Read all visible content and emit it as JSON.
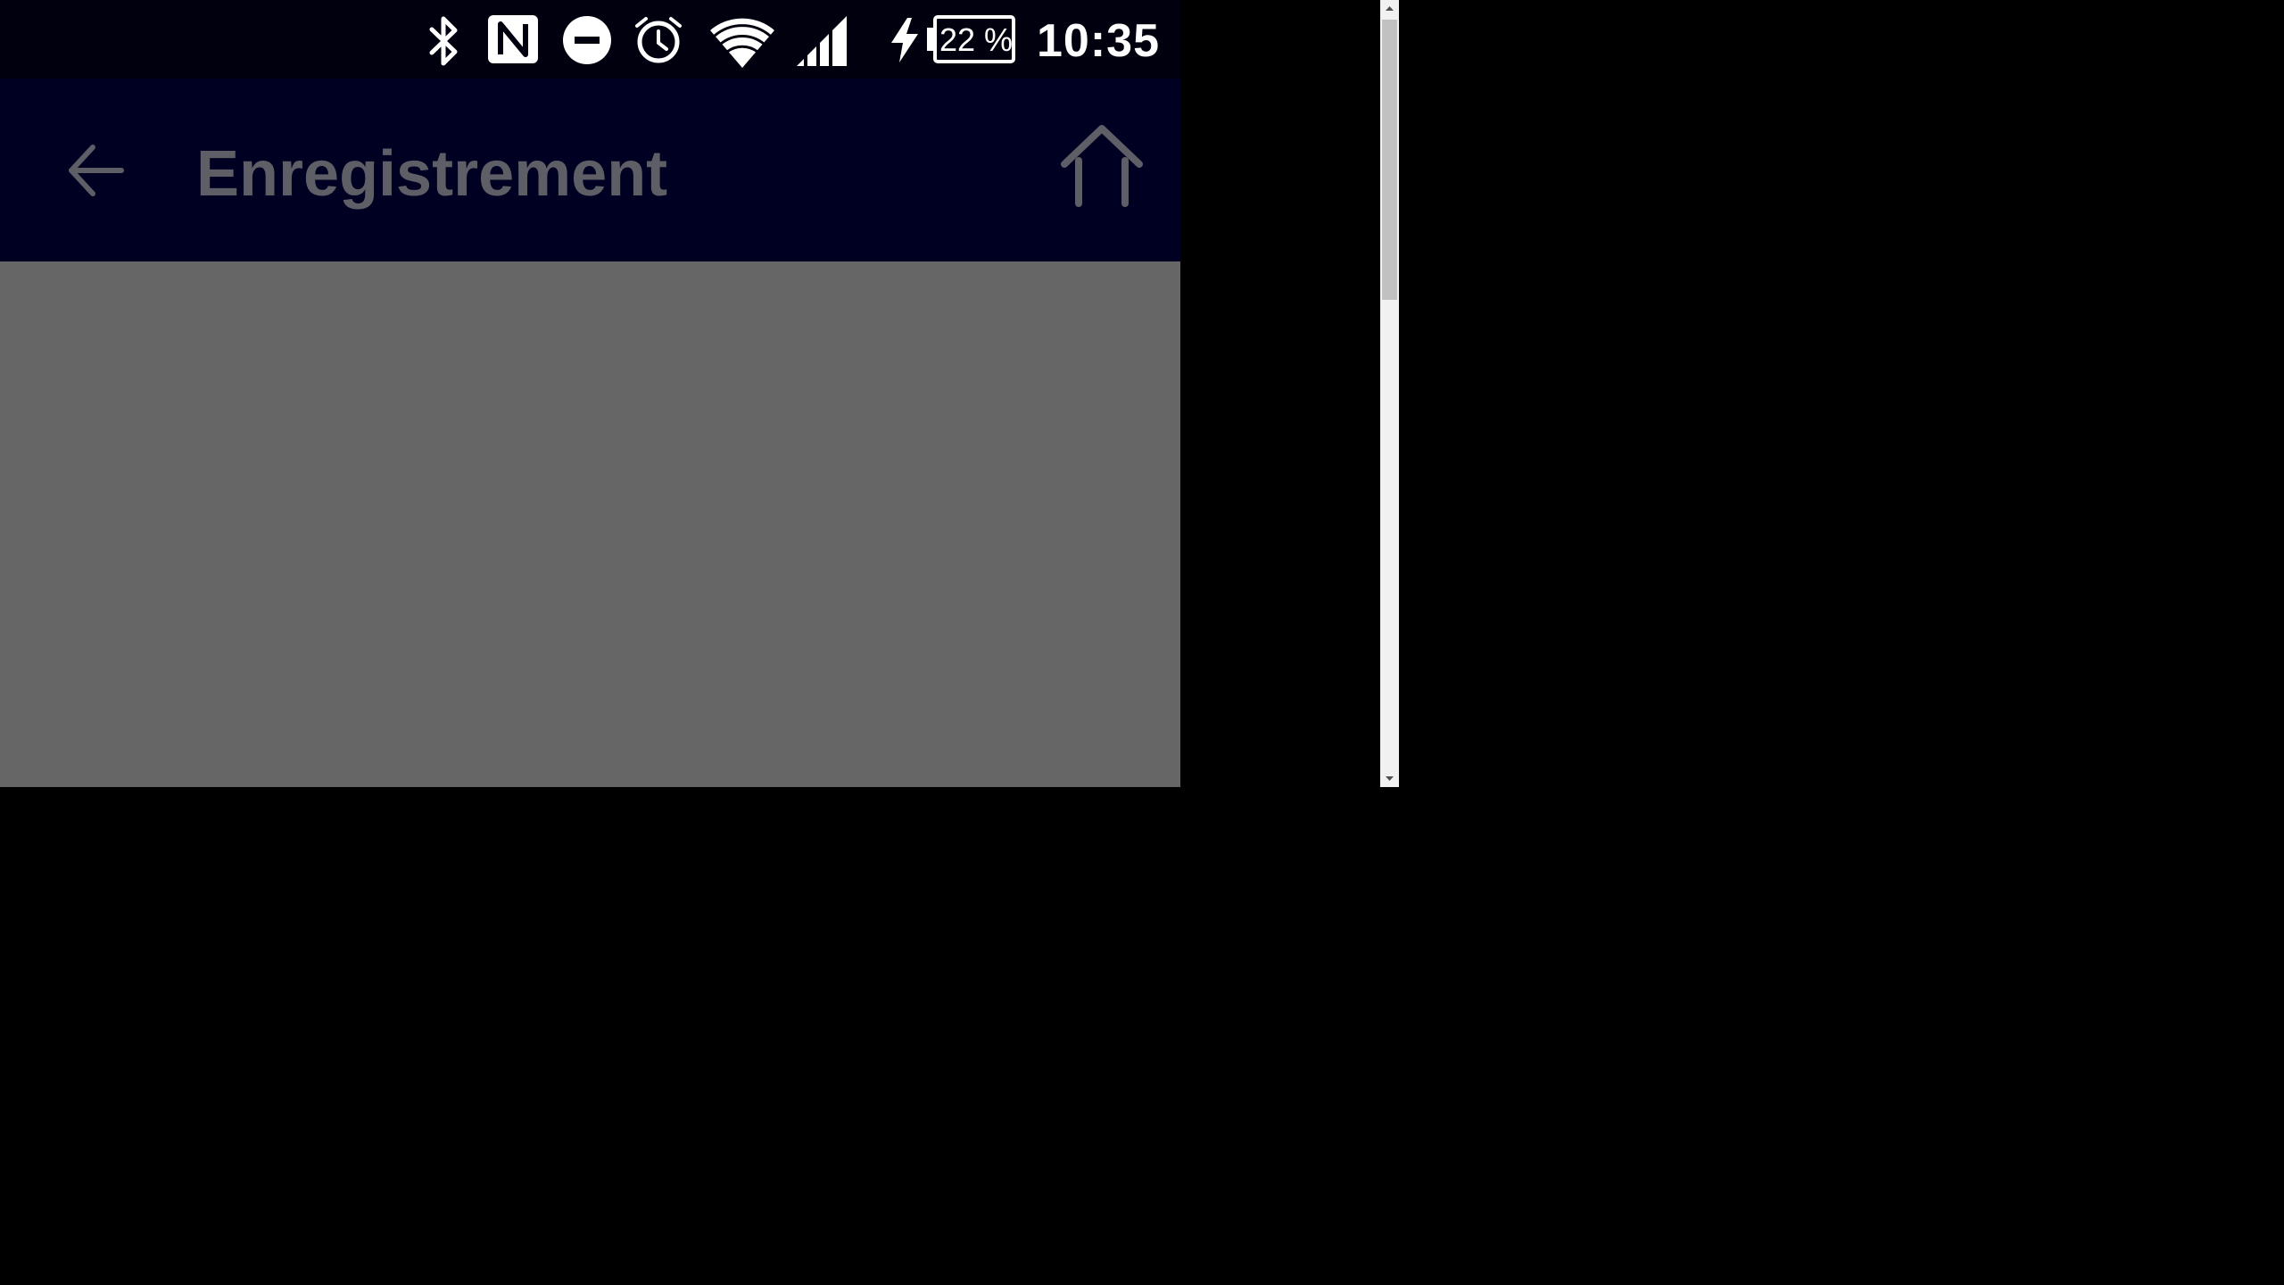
{
  "status_bar": {
    "battery": "22 %",
    "time": "10:35",
    "icons": [
      "bluetooth-icon",
      "nfc-icon",
      "do-not-disturb-icon",
      "alarm-icon",
      "wifi-icon",
      "cell-signal-icon",
      "charging-icon",
      "battery-icon"
    ]
  },
  "toolbar": {
    "title": "Enregistrement",
    "back_icon": "arrow-left-icon",
    "home_icon": "home-icon"
  },
  "colors": {
    "status_bar_bg": "#01000f",
    "toolbar_bg": "#000022",
    "content_bg": "#666666",
    "title_text": "#5e5e67"
  }
}
